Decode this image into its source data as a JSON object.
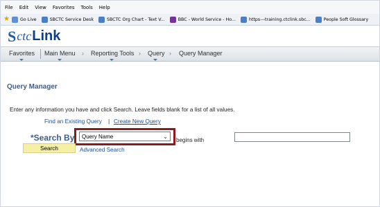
{
  "ie_menu": [
    "File",
    "Edit",
    "View",
    "Favorites",
    "Tools",
    "Help"
  ],
  "favorites": [
    {
      "label": "Go Live",
      "icon": "favorite-page-icon",
      "color": "#5b8fd6"
    },
    {
      "label": "SBCTC Service Desk",
      "icon": "favorite-page-icon",
      "color": "#4a7fc8"
    },
    {
      "label": "SBCTC Org Chart - Text V...",
      "icon": "favorite-page-icon",
      "color": "#4a7fc8"
    },
    {
      "label": "BBC - World Service - Ho...",
      "icon": "favorite-page-icon",
      "color": "#7a2fa0"
    },
    {
      "label": "https---training.ctclink.sbc...",
      "icon": "favorite-page-icon",
      "color": "#4a7fc8"
    },
    {
      "label": "People Soft Glossary",
      "icon": "favorite-page-icon",
      "color": "#4a7fc8"
    }
  ],
  "brand": {
    "mark": "S",
    "ctc": "ctc",
    "link": "Link"
  },
  "nav": {
    "favorites": "Favorites",
    "main_menu": "Main Menu",
    "reporting_tools": "Reporting Tools",
    "query": "Query",
    "query_manager": "Query Manager",
    "arrow": "›"
  },
  "page": {
    "title": "Query Manager",
    "instructions": "Enter any information you have and click Search. Leave fields blank for a list of all values.",
    "find_existing": "Find an Existing Query",
    "pipe": "|",
    "create_new": "Create New Query",
    "search_by_label": "*Search By",
    "search_by_value": "Query Name",
    "operator": "begins with",
    "search_value": "",
    "search_button": "Search",
    "advanced_search": "Advanced Search"
  },
  "colors": {
    "title": "#3b5d8c",
    "link": "#1a4f9c",
    "highlight_border": "#8b1a1a",
    "search_button_bg": "#f5f0a3"
  }
}
